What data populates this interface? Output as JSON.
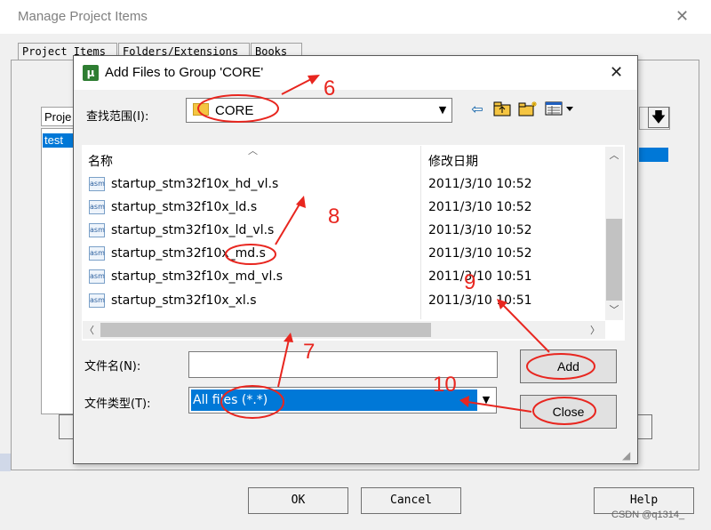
{
  "background_window": {
    "title": "Manage Project Items",
    "close_glyph": "✕",
    "tabs": [
      "Project Items",
      "Folders/Extensions",
      "Books"
    ],
    "list_header": "Proje",
    "list_selected_item": "test",
    "buttons": {
      "ok": "OK",
      "cancel": "Cancel",
      "help": "Help"
    }
  },
  "dialog": {
    "title": "Add Files to Group 'CORE'",
    "close_glyph": "✕",
    "look_in_label": "查找范围(I):",
    "look_in_value": "CORE",
    "toolbar_icons": [
      "back-arrow-icon",
      "up-folder-icon",
      "new-folder-icon",
      "view-menu-icon"
    ],
    "columns": {
      "name": "名称",
      "date": "修改日期"
    },
    "files": [
      {
        "name": "startup_stm32f10x_hd_vl.s",
        "date": "2011/3/10 10:52",
        "icon": "asm"
      },
      {
        "name": "startup_stm32f10x_ld.s",
        "date": "2011/3/10 10:52",
        "icon": "asm"
      },
      {
        "name": "startup_stm32f10x_ld_vl.s",
        "date": "2011/3/10 10:52",
        "icon": "asm"
      },
      {
        "name": "startup_stm32f10x_md.s",
        "date": "2011/3/10 10:52",
        "icon": "asm"
      },
      {
        "name": "startup_stm32f10x_md_vl.s",
        "date": "2011/3/10 10:51",
        "icon": "asm"
      },
      {
        "name": "startup_stm32f10x_xl.s",
        "date": "2011/3/10 10:51",
        "icon": "asm"
      }
    ],
    "file_name_label": "文件名(N):",
    "file_name_value": "",
    "file_type_label": "文件类型(T):",
    "file_type_value": "All files (*.*)",
    "add_button": "Add",
    "close_button": "Close"
  },
  "annotations": {
    "color": "#e8261f",
    "labels": [
      "6",
      "7",
      "8",
      "9",
      "10"
    ]
  },
  "watermark": "CSDN @q1314_",
  "colors": {
    "selection": "#0078d7",
    "annotation": "#e8261f"
  }
}
